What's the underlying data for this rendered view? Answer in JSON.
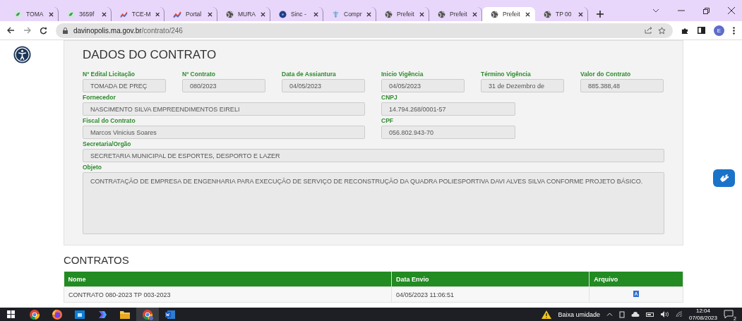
{
  "browser": {
    "tabs": [
      {
        "label": "TOMA",
        "kind": "leaf",
        "selected": false
      },
      {
        "label": "3659f",
        "kind": "leaf",
        "selected": false
      },
      {
        "label": "TCE-M",
        "kind": "chart",
        "selected": false
      },
      {
        "label": "Portal",
        "kind": "chart",
        "selected": false
      },
      {
        "label": "MURA",
        "kind": "globe",
        "selected": false
      },
      {
        "label": "Sinc -",
        "kind": "disc",
        "selected": false
      },
      {
        "label": "Compr",
        "kind": "caduceus",
        "selected": false
      },
      {
        "label": "Prefeit",
        "kind": "globe",
        "selected": false
      },
      {
        "label": "Prefeit",
        "kind": "globe",
        "selected": false
      },
      {
        "label": "Prefeit",
        "kind": "globe",
        "selected": true
      },
      {
        "label": "TP 00",
        "kind": "globe",
        "selected": false
      }
    ],
    "url_host": "davinopolis.ma.gov.br",
    "url_path": "/contrato/246",
    "profile": "E"
  },
  "contract": {
    "title": "DADOS DO CONTRATO",
    "fields": [
      {
        "label": "Nº Edital Licitação",
        "value": "TOMADA DE PREÇ"
      },
      {
        "label": "Nº Contrato",
        "value": "080/2023"
      },
      {
        "label": "Data de Assiantura",
        "value": "04/05/2023"
      },
      {
        "label": "Inicio Vigência",
        "value": "04/05/2023"
      },
      {
        "label": "Término Vigência",
        "value": "31 de Dezembro de"
      },
      {
        "label": "Valor do Contrato",
        "value": "885.388,48"
      },
      {
        "label": "Fornecedor",
        "value": "NASCIMENTO SILVA EMPREENDIMENTOS EIRELI"
      },
      {
        "label": "CNPJ",
        "value": "14.794.268/0001-57"
      },
      {
        "label": "Fiscal do Contrato",
        "value": "Marcos Vinicius Soares"
      },
      {
        "label": "CPF",
        "value": "056.802.943-70"
      },
      {
        "label": "Secretaria/Orgão",
        "value": "SECRETARIA MUNICIPAL DE ESPORTES, DESPORTO E LAZER"
      },
      {
        "label": "Objeto",
        "value": "CONTRATAÇÃO DE EMPRESA DE ENGENHARIA PARA EXECUÇÃO DE SERVIÇO DE RECONSTRUÇÃO DA QUADRA POLIESPORTIVA DAVI ALVES SILVA CONFORME PROJETO BÁSICO."
      }
    ]
  },
  "contracts": {
    "title": "CONTRATOS",
    "columns": [
      "Nome",
      "Data Envio",
      "Arquivo"
    ],
    "rows": [
      {
        "name": "CONTRATO 080-2023 TP 003-2023",
        "date": "04/05/2023 11:06:51"
      }
    ]
  },
  "taskbar": {
    "apps": [
      {
        "kind": "chrome",
        "selected": false
      },
      {
        "kind": "firefox",
        "selected": false
      },
      {
        "kind": "store",
        "selected": false
      },
      {
        "kind": "copilot",
        "selected": false
      },
      {
        "kind": "folder",
        "selected": false
      },
      {
        "kind": "chrome",
        "selected": true
      },
      {
        "kind": "word",
        "selected": false
      }
    ],
    "weather": "Baixa umidade",
    "time": "12:04",
    "date": "07/08/2023",
    "notifications": "2"
  }
}
